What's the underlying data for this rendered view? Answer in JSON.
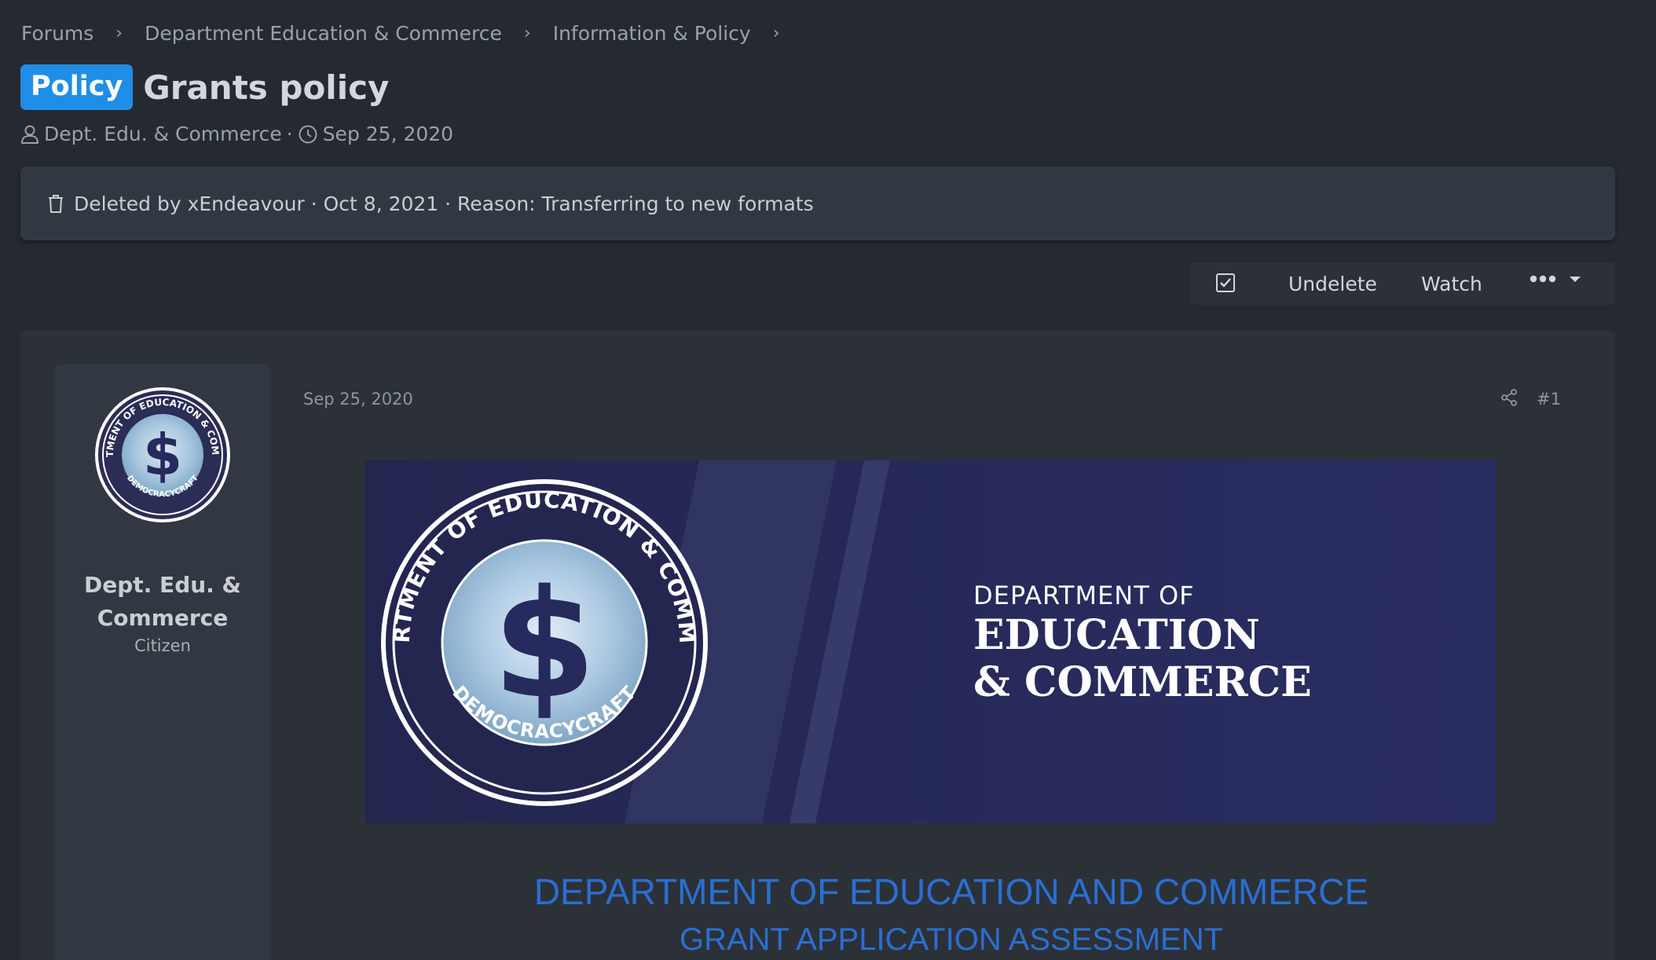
{
  "breadcrumb": [
    "Forums",
    "Department Education & Commerce",
    "Information & Policy"
  ],
  "thread": {
    "prefix": "Policy",
    "title": "Grants policy",
    "author": "Dept. Edu. & Commerce",
    "date": "Sep 25, 2020"
  },
  "deleted_notice": {
    "text": "Deleted by xEndeavour · Oct 8, 2021 · Reason: Transferring to new formats"
  },
  "actions": {
    "undelete": "Undelete",
    "watch": "Watch"
  },
  "post": {
    "date": "Sep 25, 2020",
    "number": "#1",
    "user_name_line1": "Dept. Edu. &",
    "user_name_line2": "Commerce",
    "user_title": "Citizen",
    "heading_main": "DEPARTMENT OF EDUCATION AND COMMERCE",
    "heading_sub": "GRANT APPLICATION ASSESSMENT"
  },
  "banner": {
    "line1": "DEPARTMENT OF",
    "line2": "EDUCATION",
    "line3": "& COMMERCE",
    "seal_top": "DEPARTMENT OF EDUCATION & COMMERCE",
    "seal_bottom": "DEMOCRACYCRAFT",
    "seal_symbol": "$"
  },
  "colors": {
    "background": "#252a30",
    "badge": "#1f8ee6",
    "banner_navy": "#262a5c",
    "heading_blue": "#2a6fd1"
  },
  "icons": [
    "user-icon",
    "clock-icon",
    "trash-icon",
    "checkbox-icon",
    "more-dots-icon",
    "share-icon"
  ]
}
